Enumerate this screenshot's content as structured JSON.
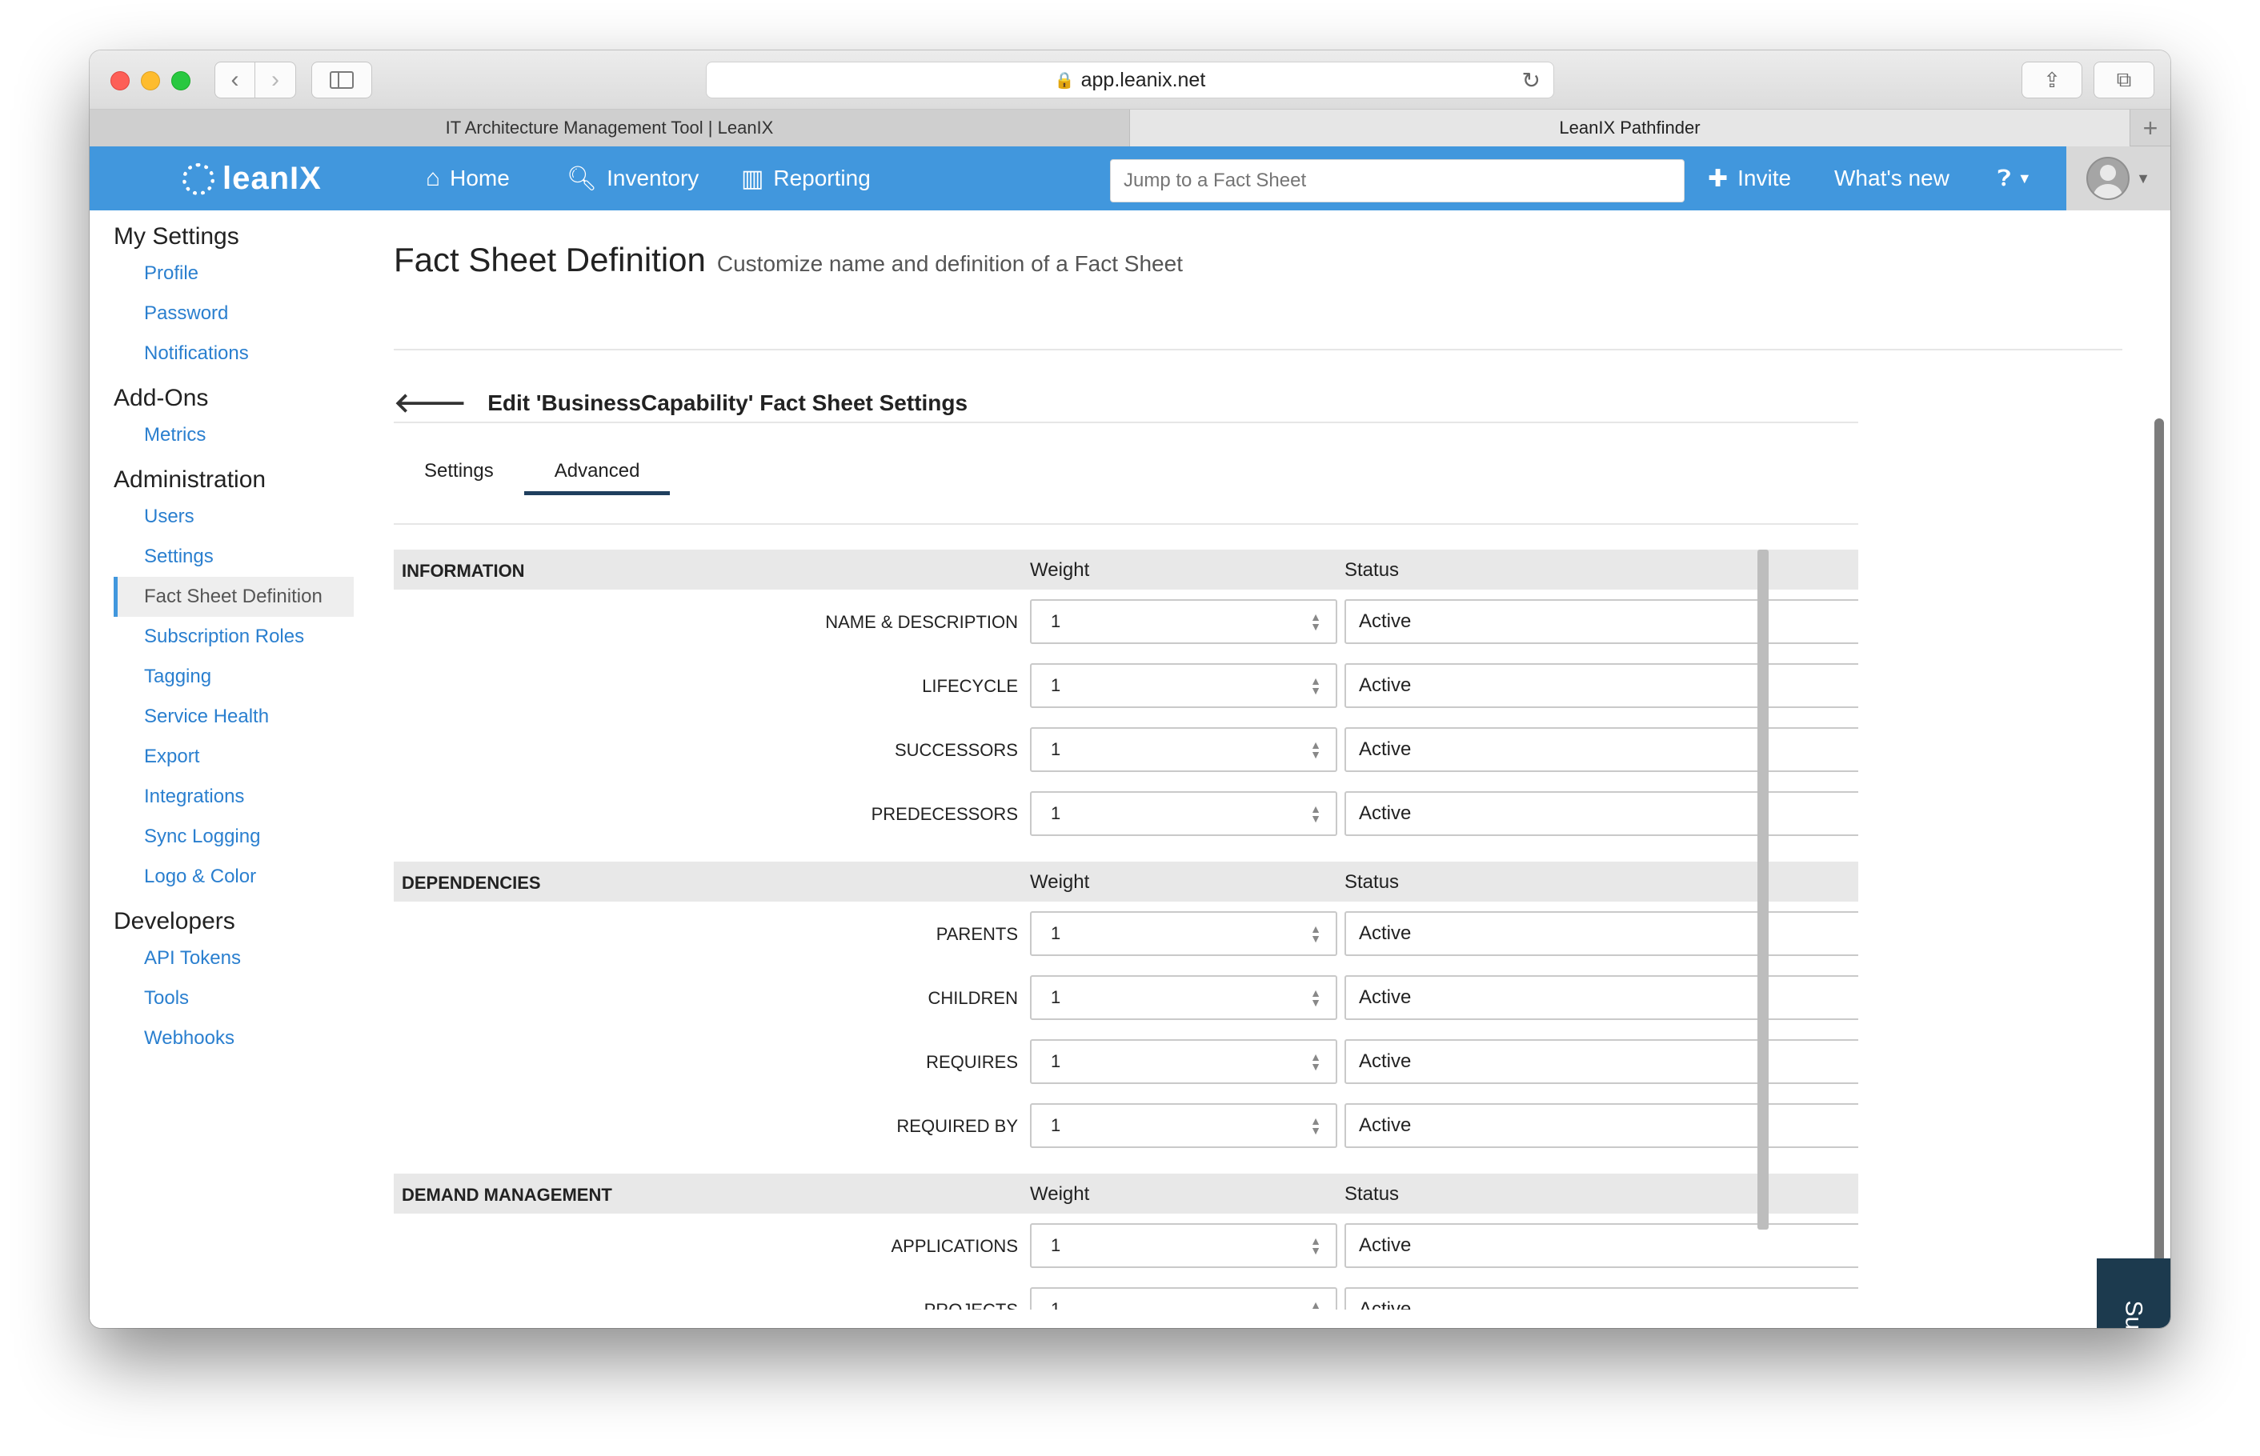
{
  "browser": {
    "url": "app.leanix.net",
    "tabs": [
      {
        "label": "IT Architecture Management Tool | LeanIX"
      },
      {
        "label": "LeanIX Pathfinder"
      }
    ]
  },
  "header": {
    "logo_text": "leanIX",
    "nav": {
      "home": "Home",
      "inventory": "Inventory",
      "reporting": "Reporting"
    },
    "search_placeholder": "Jump to a Fact Sheet",
    "invite": "Invite",
    "whats_new": "What's new",
    "icons": {
      "home": "home-icon",
      "inventory": "search-icon",
      "reporting": "bar-chart-icon",
      "invite": "plus-icon",
      "help": "question-icon",
      "user": "avatar-icon"
    },
    "brand_color": "#4197dd"
  },
  "sidebar": {
    "groups": [
      {
        "title": "My Settings",
        "items": [
          "Profile",
          "Password",
          "Notifications"
        ]
      },
      {
        "title": "Add-Ons",
        "items": [
          "Metrics"
        ]
      },
      {
        "title": "Administration",
        "items": [
          "Users",
          "Settings",
          "Fact Sheet Definition",
          "Subscription Roles",
          "Tagging",
          "Service Health",
          "Export",
          "Integrations",
          "Sync Logging",
          "Logo & Color"
        ]
      },
      {
        "title": "Developers",
        "items": [
          "API Tokens",
          "Tools",
          "Webhooks"
        ]
      }
    ],
    "active_item": "Fact Sheet Definition"
  },
  "main": {
    "title": "Fact Sheet Definition",
    "subtitle": "Customize name and definition of a Fact Sheet",
    "edit_title": "Edit 'BusinessCapability' Fact Sheet Settings",
    "tabs": [
      {
        "label": "Settings"
      },
      {
        "label": "Advanced"
      }
    ],
    "active_tab": "Advanced",
    "columns": {
      "weight": "Weight",
      "status": "Status"
    },
    "sections": [
      {
        "name": "INFORMATION",
        "rows": [
          {
            "label": "NAME & DESCRIPTION",
            "weight": "1",
            "status": "Active"
          },
          {
            "label": "LIFECYCLE",
            "weight": "1",
            "status": "Active"
          },
          {
            "label": "SUCCESSORS",
            "weight": "1",
            "status": "Active"
          },
          {
            "label": "PREDECESSORS",
            "weight": "1",
            "status": "Active"
          }
        ]
      },
      {
        "name": "DEPENDENCIES",
        "rows": [
          {
            "label": "PARENTS",
            "weight": "1",
            "status": "Active"
          },
          {
            "label": "CHILDREN",
            "weight": "1",
            "status": "Active"
          },
          {
            "label": "REQUIRES",
            "weight": "1",
            "status": "Active"
          },
          {
            "label": "REQUIRED BY",
            "weight": "1",
            "status": "Active"
          }
        ]
      },
      {
        "name": "DEMAND MANAGEMENT",
        "rows": [
          {
            "label": "APPLICATIONS",
            "weight": "1",
            "status": "Active"
          },
          {
            "label": "PROJECTS",
            "weight": "1",
            "status": "Active"
          }
        ]
      }
    ]
  },
  "support_label": "Support"
}
